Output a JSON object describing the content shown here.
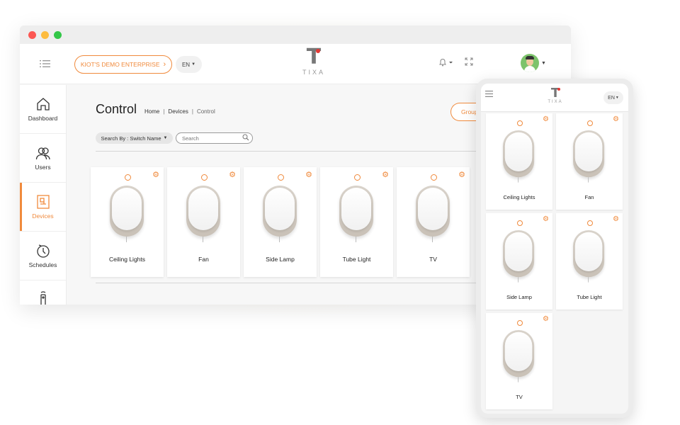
{
  "colors": {
    "accent": "#f08a3c",
    "close": "#fc5753",
    "minimize": "#fdbc40",
    "maximize": "#33c748",
    "logo_dot": "#e53935"
  },
  "header": {
    "enterprise_label": "KIOT'S DEMO ENTERPRISE",
    "language": "EN",
    "logo_letter": "T",
    "logo_word": "TIXA"
  },
  "sidebar": {
    "items": [
      {
        "label": "Dashboard",
        "icon": "home-icon"
      },
      {
        "label": "Users",
        "icon": "users-icon"
      },
      {
        "label": "Devices",
        "icon": "devices-icon",
        "active": true
      },
      {
        "label": "Schedules",
        "icon": "schedules-icon"
      },
      {
        "label": "",
        "icon": "remote-icon"
      }
    ]
  },
  "main": {
    "title": "Control",
    "breadcrumb": [
      "Home",
      "Devices",
      "Control"
    ],
    "group_button": "Group",
    "search_by_label": "Search By : Switch Name",
    "search_placeholder": "Search",
    "devices": [
      "Ceiling Lights",
      "Fan",
      "Side Lamp",
      "Tube Light",
      "TV"
    ]
  },
  "mobile": {
    "language": "EN",
    "logo_letter": "T",
    "logo_word": "TIXA",
    "devices": [
      "Ceiling Lights",
      "Fan",
      "Side Lamp",
      "Tube Light",
      "TV"
    ]
  }
}
